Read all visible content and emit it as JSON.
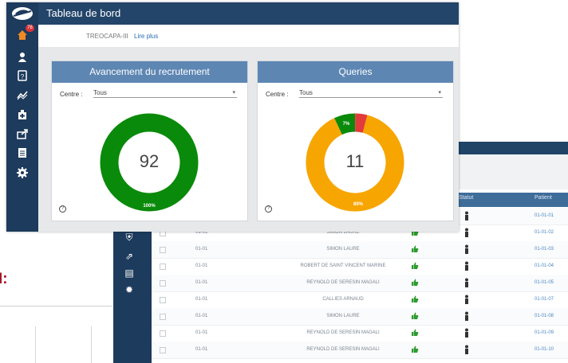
{
  "header": {
    "title": "Tableau de bord"
  },
  "study": {
    "name": "TREOCAPA-III",
    "more_link": "Lire plus"
  },
  "sidebar": {
    "notification_count": "76"
  },
  "panels": {
    "recruitment": {
      "title": "Avancement du recrutement",
      "filter_label": "Centre :",
      "filter_value": "Tous",
      "center_value": "92",
      "segments": [
        {
          "label": "100%",
          "fraction": 1.0,
          "color": "#0a8a0a"
        }
      ]
    },
    "queries": {
      "title": "Queries",
      "filter_label": "Centre :",
      "filter_value": "Tous",
      "center_value": "11",
      "segments": [
        {
          "label": "89%",
          "fraction": 0.89,
          "color": "#f7a500"
        },
        {
          "label": "7%",
          "fraction": 0.07,
          "color": "#0a8a0a"
        },
        {
          "label": "",
          "fraction": 0.04,
          "color": "#e23b3b"
        }
      ]
    }
  },
  "background_page": {
    "fragment_label": "I:",
    "table_header": [
      "Statut",
      "Patient"
    ],
    "rows": [
      {
        "site": "01-01",
        "name": "FERBRANT CYRIL",
        "patient": "01-01-01"
      },
      {
        "site": "01-01",
        "name": "SIMON LAURE",
        "patient": "01-01-02"
      },
      {
        "site": "01-01",
        "name": "SIMON LAURE",
        "patient": "01-01-03"
      },
      {
        "site": "01-01",
        "name": "ROBERT DE SAINT VINCENT MARINE",
        "patient": "01-01-04"
      },
      {
        "site": "01-01",
        "name": "REYNOLD DE SERESIN MAGALI",
        "patient": "01-01-05"
      },
      {
        "site": "01-01",
        "name": "CALLIES ARNAUD",
        "patient": "01-01-07"
      },
      {
        "site": "01-01",
        "name": "SIMON LAURE",
        "patient": "01-01-08"
      },
      {
        "site": "01-01",
        "name": "REYNOLD DE SERESIN MAGALI",
        "patient": "01-01-09"
      },
      {
        "site": "01-01",
        "name": "REYNOLD DE SERESIN MAGALI",
        "patient": "01-01-10"
      }
    ]
  },
  "colors": {
    "sidebar": "#1d3b5c",
    "header": "#23456a",
    "panel_header": "#5d86b3",
    "accent_link": "#2a6db5"
  }
}
